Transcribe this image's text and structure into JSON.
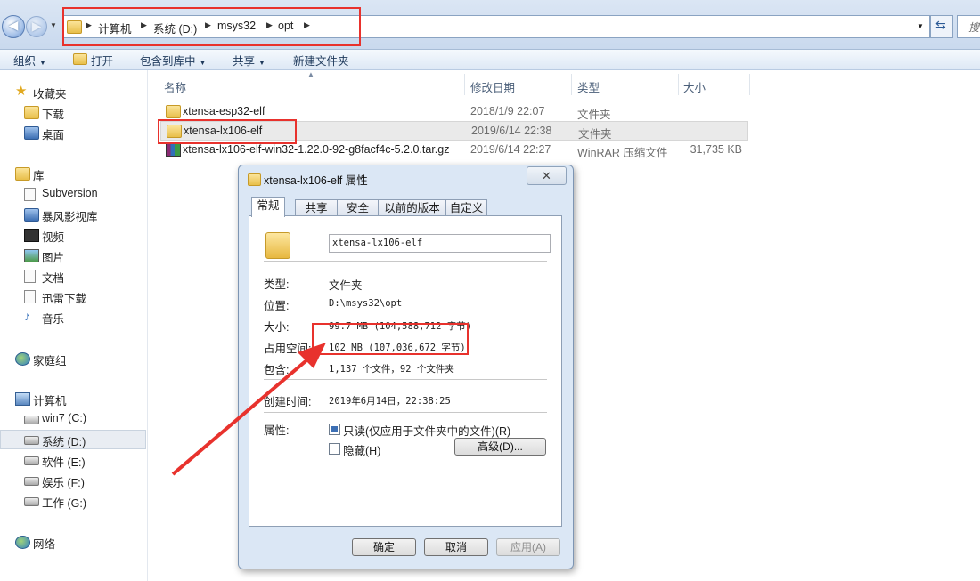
{
  "address": {
    "crumbs": [
      "计算机",
      "系统 (D:)",
      "msys32",
      "opt"
    ],
    "search_placeholder": "搜"
  },
  "toolbar": {
    "organize": "组织",
    "open": "打开",
    "include_in_library": "包含到库中",
    "share": "共享",
    "new_folder": "新建文件夹"
  },
  "sidebar": {
    "favorites": "收藏夹",
    "favorites_items": [
      "下载",
      "桌面"
    ],
    "libraries": "库",
    "library_items": [
      "Subversion",
      "暴风影视库",
      "视频",
      "图片",
      "文档",
      "迅雷下载",
      "音乐"
    ],
    "homegroup": "家庭组",
    "computer": "计算机",
    "drives": [
      "win7 (C:)",
      "系统 (D:)",
      "软件 (E:)",
      "娱乐 (F:)",
      "工作 (G:)"
    ],
    "network": "网络"
  },
  "columns": {
    "name": "名称",
    "modified": "修改日期",
    "type": "类型",
    "size": "大小"
  },
  "files": [
    {
      "name": "xtensa-esp32-elf",
      "modified": "2018/1/9 22:07",
      "type": "文件夹",
      "size": ""
    },
    {
      "name": "xtensa-lx106-elf",
      "modified": "2019/6/14 22:38",
      "type": "文件夹",
      "size": ""
    },
    {
      "name": "xtensa-lx106-elf-win32-1.22.0-92-g8facf4c-5.2.0.tar.gz",
      "modified": "2019/6/14 22:27",
      "type": "WinRAR 压缩文件",
      "size": "31,735 KB"
    }
  ],
  "dialog": {
    "title": "xtensa-lx106-elf 属性",
    "tabs": [
      "常规",
      "共享",
      "安全",
      "以前的版本",
      "自定义"
    ],
    "folder_name": "xtensa-lx106-elf",
    "labels": {
      "type": "类型:",
      "location": "位置:",
      "size": "大小:",
      "size_on_disk": "占用空间:",
      "contains": "包含:",
      "created": "创建时间:",
      "attributes": "属性:"
    },
    "values": {
      "type": "文件夹",
      "location": "D:\\msys32\\opt",
      "size": "99.7 MB (104,588,712 字节)",
      "size_on_disk": "102 MB (107,036,672 字节)",
      "contains": "1,137 个文件，92 个文件夹",
      "created": "2019年6月14日，22:38:25"
    },
    "readonly_label": "只读(仅应用于文件夹中的文件)(R)",
    "readonly_checked": true,
    "hidden_label": "隐藏(H)",
    "hidden_checked": false,
    "advanced_button": "高级(D)...",
    "ok": "确定",
    "cancel": "取消",
    "apply": "应用(A)",
    "close_glyph": "✕"
  },
  "colors": {
    "annotation_red": "#e8322d",
    "accent_blue": "#3c6fb4"
  }
}
